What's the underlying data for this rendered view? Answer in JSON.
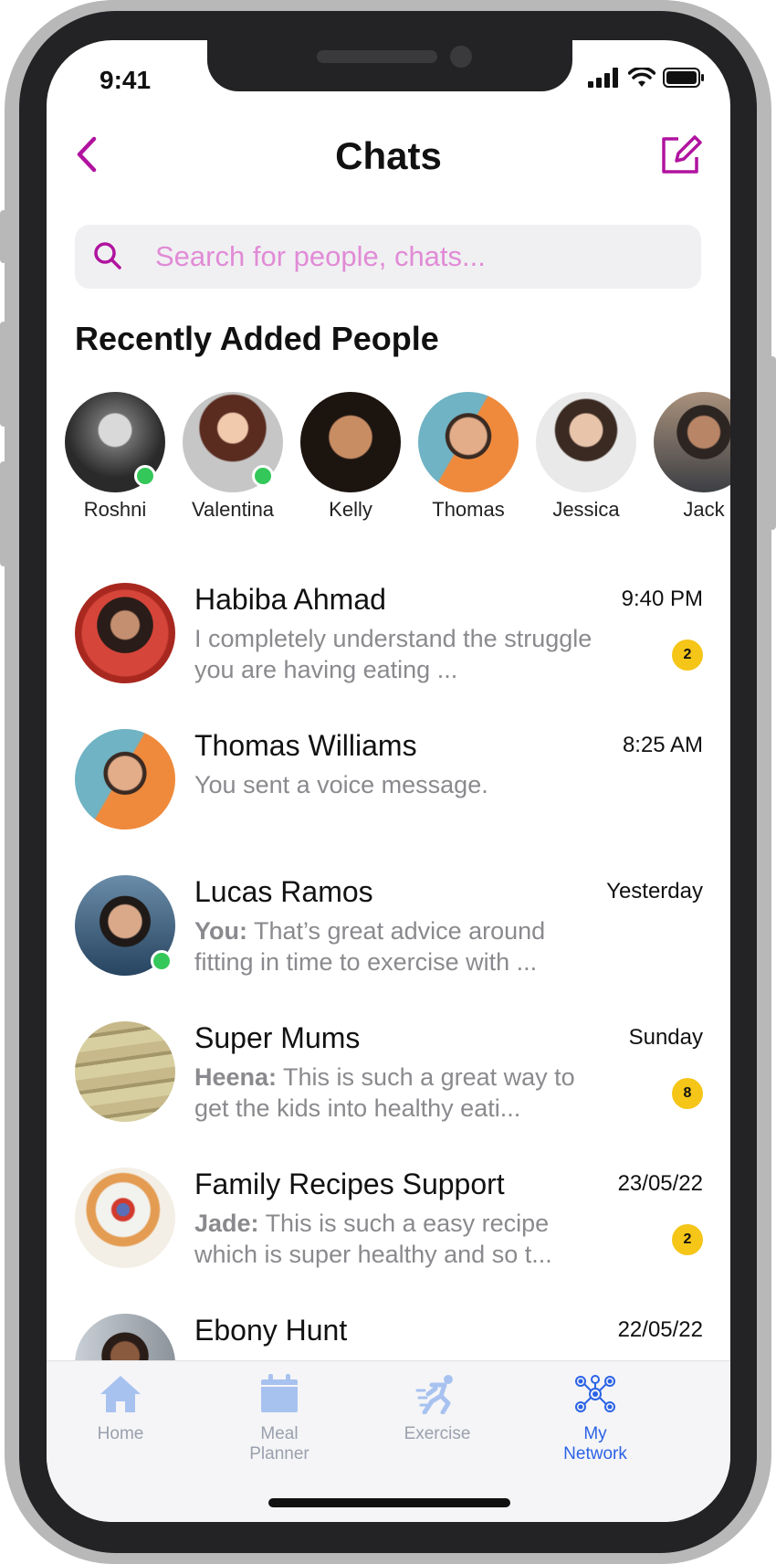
{
  "status": {
    "time": "9:41"
  },
  "header": {
    "title": "Chats"
  },
  "search": {
    "placeholder": "Search for people, chats..."
  },
  "recent": {
    "title": "Recently Added People",
    "people": [
      {
        "name": "Roshni",
        "online": true
      },
      {
        "name": "Valentina",
        "online": true
      },
      {
        "name": "Kelly",
        "online": false
      },
      {
        "name": "Thomas",
        "online": false
      },
      {
        "name": "Jessica",
        "online": false
      },
      {
        "name": "Jack",
        "online": false
      }
    ]
  },
  "chats": [
    {
      "name": "Habiba Ahmad",
      "time": "9:40 PM",
      "sender": "",
      "preview": "I completely understand the struggle you are having eating ...",
      "badge": "2",
      "online": false
    },
    {
      "name": "Thomas Williams",
      "time": "8:25 AM",
      "sender": "",
      "preview": "You sent a voice message.",
      "badge": "",
      "online": false
    },
    {
      "name": "Lucas Ramos",
      "time": "Yesterday",
      "sender": "You:",
      "preview": "That’s great advice around fitting in time to exercise with ...",
      "badge": "",
      "online": true
    },
    {
      "name": "Super Mums",
      "time": "Sunday",
      "sender": "Heena:",
      "preview": "This is such a great way to get the kids into healthy eati...",
      "badge": "8",
      "online": false
    },
    {
      "name": "Family Recipes Support",
      "time": "23/05/22",
      "sender": "Jade:",
      "preview": "This is such a easy recipe which is super healthy and so t...",
      "badge": "2",
      "online": false
    },
    {
      "name": "Ebony Hunt",
      "time": "22/05/22",
      "sender": "",
      "preview": "",
      "badge": "",
      "online": false
    }
  ],
  "tabs": [
    {
      "label": "Home",
      "icon": "home-icon",
      "active": false
    },
    {
      "label": "Meal Planner",
      "icon": "calendar-icon",
      "active": false
    },
    {
      "label": "Exercise",
      "icon": "running-icon",
      "active": false
    },
    {
      "label": "My Network",
      "icon": "network-icon",
      "active": true
    }
  ],
  "colors": {
    "accent": "#b0139f",
    "placeholder": "#e18bd6",
    "badge": "#f5c518",
    "online": "#34c759",
    "tab_active": "#2b63e6",
    "tab_inactive": "#9aa0ad"
  }
}
